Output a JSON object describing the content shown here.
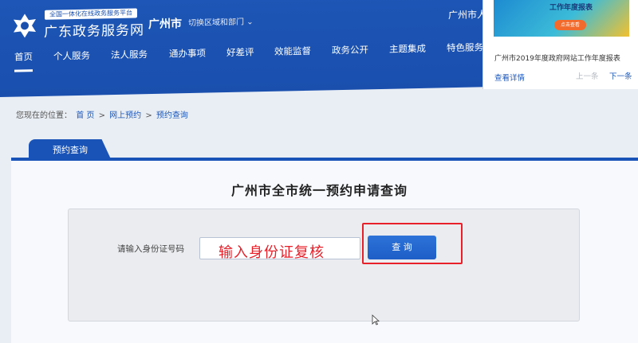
{
  "header": {
    "portal_tagline": "全国一体化在线政务服务平台",
    "site_name": "广东政务服务网",
    "city": "广州市",
    "switch_label": "切换区域和部门",
    "city_right": "广州市人",
    "nav": [
      {
        "label": "首页",
        "active": true
      },
      {
        "label": "个人服务"
      },
      {
        "label": "法人服务"
      },
      {
        "label": "通办事项"
      },
      {
        "label": "好差评"
      },
      {
        "label": "效能监督"
      },
      {
        "label": "政务公开"
      },
      {
        "label": "主题集成"
      },
      {
        "label": "特色服务"
      }
    ]
  },
  "popup": {
    "banner_title": "工作年度报表",
    "banner_button": "点击查看",
    "title": "广州市2019年度政府网站工作年度报表",
    "detail_link": "查看详情",
    "prev_label": "上一条",
    "next_label": "下一条"
  },
  "breadcrumb": {
    "prefix": "您现在的位置：",
    "items": [
      "首 页",
      "网上预约",
      "预约查询"
    ],
    "separator": ">"
  },
  "tab": {
    "label": "预约查询"
  },
  "form": {
    "title": "广州市全市统一预约申请查询",
    "id_label": "请输入身份证号码",
    "id_value": "",
    "annotation": "输入身份证复核",
    "query_button": "查 询"
  },
  "colors": {
    "header_blue": "#1a4fae",
    "button_blue": "#1d5ec7",
    "annotation_red": "#e8202a"
  }
}
